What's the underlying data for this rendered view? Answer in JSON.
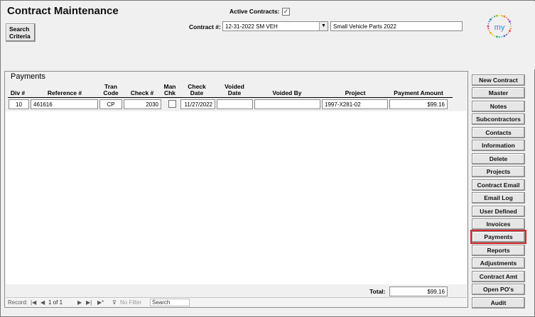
{
  "header": {
    "title": "Contract Maintenance",
    "search_button": "Search\nCriteria",
    "active_contracts_label": "Active Contracts:",
    "active_contracts_checked": true,
    "contract_label": "Contract #:",
    "contract_value": "12-31-2022 SM VEH",
    "contract_name": "Small Vehicle Parts 2022",
    "logo_text": "my"
  },
  "payments": {
    "section_title": "Payments",
    "columns": {
      "div": "Div #",
      "reference": "Reference #",
      "tran_code": "Tran\nCode",
      "check_no": "Check #",
      "man_chk": "Man\nChk",
      "check_date": "Check\nDate",
      "voided_date": "Voided\nDate",
      "voided_by": "Voided By",
      "project": "Project",
      "payment_amount": "Payment Amount"
    },
    "rows": [
      {
        "div": "10",
        "reference": "461616",
        "tran_code": "CP",
        "check_no": "2030",
        "man_chk": false,
        "check_date": "11/27/2022",
        "voided_date": "",
        "voided_by": "",
        "project": "1997-X281-02",
        "payment_amount": "$99.16"
      }
    ],
    "total_label": "Total:",
    "total_value": "$99.16"
  },
  "navigation": {
    "record_label": "Record:",
    "first": "|◀",
    "prev": "◀",
    "position": "1 of 1",
    "next": "▶",
    "last": "▶|",
    "new": "▶*",
    "no_filter": "No Filter",
    "search_placeholder": "Search"
  },
  "sidebar": {
    "selected": "Payments",
    "items": [
      "New Contract",
      "Master",
      "Notes",
      "Subcontractors",
      "Contacts",
      "Information",
      "Delete",
      "Projects",
      "Contract Email",
      "Email Log",
      "User Defined",
      "Invoices",
      "Payments",
      "Reports",
      "Adjustments",
      "Contract Amt",
      "Open PO's",
      "Audit"
    ]
  },
  "colors": {
    "selected_outline": "#d9262c",
    "form_background": "#f0f0f0"
  }
}
